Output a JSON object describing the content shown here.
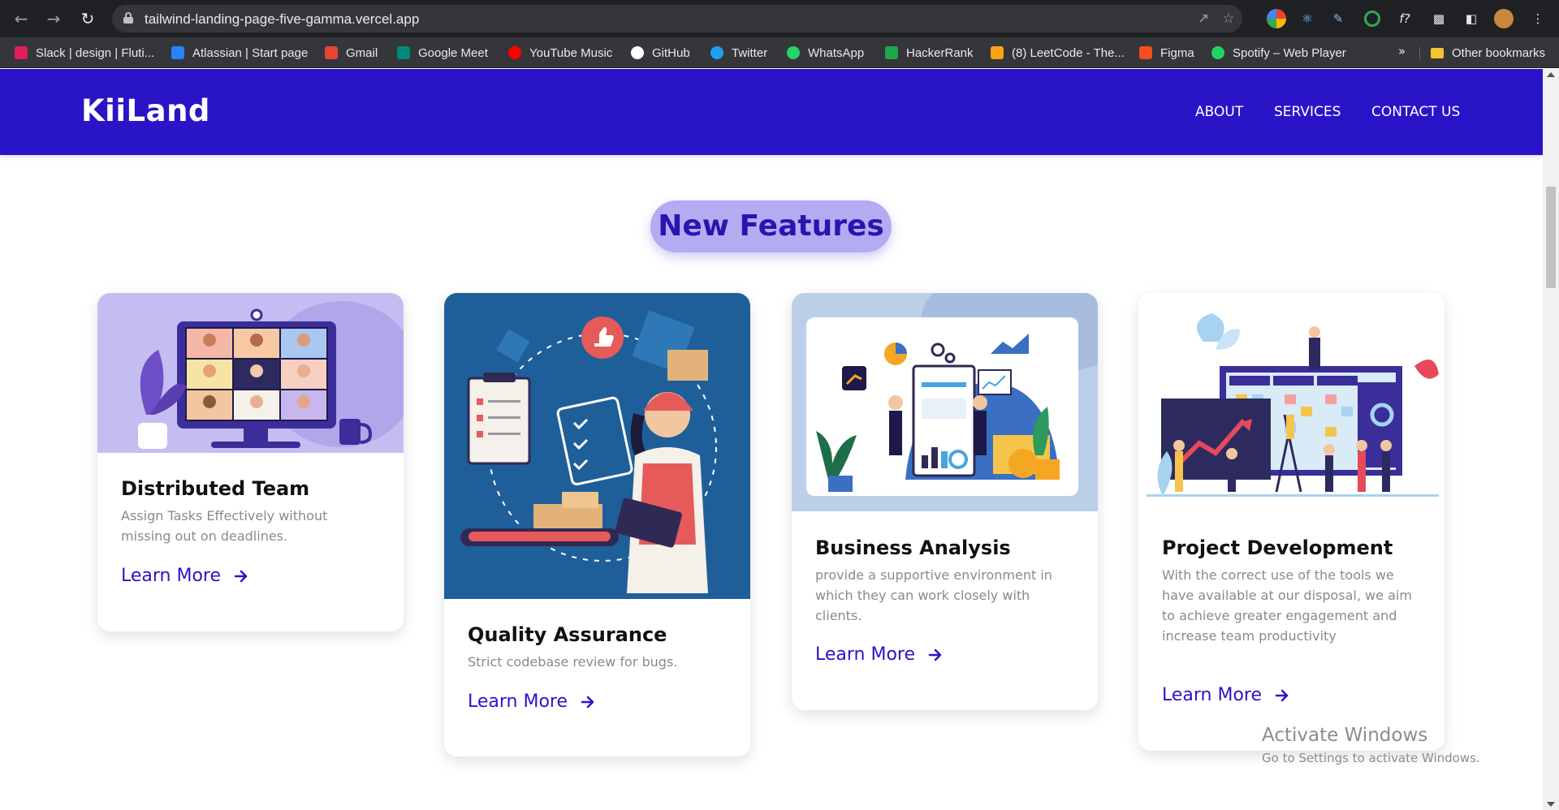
{
  "browser": {
    "url": "tailwind-landing-page-five-gamma.vercel.app",
    "bookmarks": [
      {
        "label": "Slack | design | Fluti...",
        "icon": "slack-icon",
        "color": "#e01e5a"
      },
      {
        "label": "Atlassian | Start page",
        "icon": "atlassian-icon",
        "color": "#2684ff"
      },
      {
        "label": "Gmail",
        "icon": "gmail-icon",
        "color": "#ea4335"
      },
      {
        "label": "Google Meet",
        "icon": "google-meet-icon",
        "color": "#00897b"
      },
      {
        "label": "YouTube Music",
        "icon": "youtube-music-icon",
        "color": "#ff0000"
      },
      {
        "label": "GitHub",
        "icon": "github-icon",
        "color": "#ffffff"
      },
      {
        "label": "Twitter",
        "icon": "twitter-icon",
        "color": "#1da1f2"
      },
      {
        "label": "WhatsApp",
        "icon": "whatsapp-icon",
        "color": "#25d366"
      },
      {
        "label": "HackerRank",
        "icon": "hackerrank-icon",
        "color": "#1ba94c"
      },
      {
        "label": "(8) LeetCode - The...",
        "icon": "leetcode-icon",
        "color": "#ffa116"
      },
      {
        "label": "Figma",
        "icon": "figma-icon",
        "color": "#f24e1e"
      },
      {
        "label": "Spotify – Web Player",
        "icon": "spotify-icon",
        "color": "#1ed760"
      }
    ],
    "more": "»",
    "other_bookmarks": "Other bookmarks"
  },
  "site": {
    "logo": "KiiLand",
    "nav": [
      "ABOUT",
      "SERVICES",
      "CONTACT US"
    ],
    "accent": "#2a14c8"
  },
  "section": {
    "title": "New Features"
  },
  "cards": [
    {
      "title": "Distributed Team",
      "desc": "Assign Tasks Effectively without missing out on deadlines.",
      "cta": "Learn More"
    },
    {
      "title": "Quality Assurance",
      "desc": "Strict codebase review for bugs.",
      "cta": "Learn More"
    },
    {
      "title": "Business Analysis",
      "desc": "provide a supportive environment in which they can work closely with clients.",
      "cta": "Learn More"
    },
    {
      "title": "Project Development",
      "desc": "With the correct use of the tools we have available at our disposal, we aim to achieve greater engagement and increase team productivity",
      "cta": "Learn More"
    }
  ],
  "watermark": {
    "title": "Activate Windows",
    "subtitle": "Go to Settings to activate Windows."
  }
}
